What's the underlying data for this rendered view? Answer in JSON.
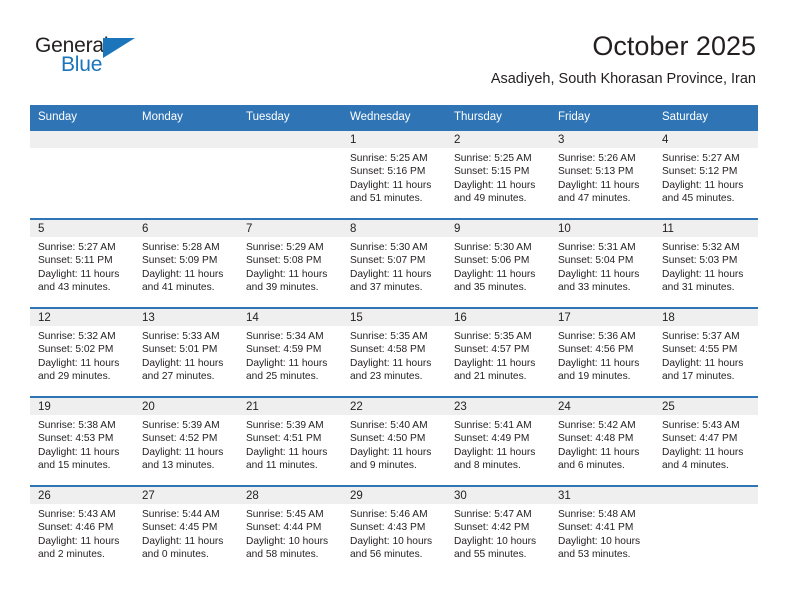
{
  "brand": {
    "name_top": "General",
    "name_bottom": "Blue",
    "triangle_color": "#1b75bb",
    "text_color": "#231f20"
  },
  "header": {
    "title": "October 2025",
    "subtitle": "Asadiyeh, South Khorasan Province, Iran"
  },
  "theme": {
    "header_blue": "#2f74b5",
    "daynum_band": "#efefef",
    "text": "#231f20",
    "cell_bg": "#ffffff"
  },
  "calendar": {
    "weekday_headers": [
      "Sunday",
      "Monday",
      "Tuesday",
      "Wednesday",
      "Thursday",
      "Friday",
      "Saturday"
    ],
    "weeks": [
      [
        {
          "day": "",
          "sunrise": "",
          "sunset": "",
          "daylight_line1": "",
          "daylight_line2": "",
          "empty": true
        },
        {
          "day": "",
          "sunrise": "",
          "sunset": "",
          "daylight_line1": "",
          "daylight_line2": "",
          "empty": true
        },
        {
          "day": "",
          "sunrise": "",
          "sunset": "",
          "daylight_line1": "",
          "daylight_line2": "",
          "empty": true
        },
        {
          "day": "1",
          "sunrise": "Sunrise: 5:25 AM",
          "sunset": "Sunset: 5:16 PM",
          "daylight_line1": "Daylight: 11 hours",
          "daylight_line2": "and 51 minutes."
        },
        {
          "day": "2",
          "sunrise": "Sunrise: 5:25 AM",
          "sunset": "Sunset: 5:15 PM",
          "daylight_line1": "Daylight: 11 hours",
          "daylight_line2": "and 49 minutes."
        },
        {
          "day": "3",
          "sunrise": "Sunrise: 5:26 AM",
          "sunset": "Sunset: 5:13 PM",
          "daylight_line1": "Daylight: 11 hours",
          "daylight_line2": "and 47 minutes."
        },
        {
          "day": "4",
          "sunrise": "Sunrise: 5:27 AM",
          "sunset": "Sunset: 5:12 PM",
          "daylight_line1": "Daylight: 11 hours",
          "daylight_line2": "and 45 minutes."
        }
      ],
      [
        {
          "day": "5",
          "sunrise": "Sunrise: 5:27 AM",
          "sunset": "Sunset: 5:11 PM",
          "daylight_line1": "Daylight: 11 hours",
          "daylight_line2": "and 43 minutes."
        },
        {
          "day": "6",
          "sunrise": "Sunrise: 5:28 AM",
          "sunset": "Sunset: 5:09 PM",
          "daylight_line1": "Daylight: 11 hours",
          "daylight_line2": "and 41 minutes."
        },
        {
          "day": "7",
          "sunrise": "Sunrise: 5:29 AM",
          "sunset": "Sunset: 5:08 PM",
          "daylight_line1": "Daylight: 11 hours",
          "daylight_line2": "and 39 minutes."
        },
        {
          "day": "8",
          "sunrise": "Sunrise: 5:30 AM",
          "sunset": "Sunset: 5:07 PM",
          "daylight_line1": "Daylight: 11 hours",
          "daylight_line2": "and 37 minutes."
        },
        {
          "day": "9",
          "sunrise": "Sunrise: 5:30 AM",
          "sunset": "Sunset: 5:06 PM",
          "daylight_line1": "Daylight: 11 hours",
          "daylight_line2": "and 35 minutes."
        },
        {
          "day": "10",
          "sunrise": "Sunrise: 5:31 AM",
          "sunset": "Sunset: 5:04 PM",
          "daylight_line1": "Daylight: 11 hours",
          "daylight_line2": "and 33 minutes."
        },
        {
          "day": "11",
          "sunrise": "Sunrise: 5:32 AM",
          "sunset": "Sunset: 5:03 PM",
          "daylight_line1": "Daylight: 11 hours",
          "daylight_line2": "and 31 minutes."
        }
      ],
      [
        {
          "day": "12",
          "sunrise": "Sunrise: 5:32 AM",
          "sunset": "Sunset: 5:02 PM",
          "daylight_line1": "Daylight: 11 hours",
          "daylight_line2": "and 29 minutes."
        },
        {
          "day": "13",
          "sunrise": "Sunrise: 5:33 AM",
          "sunset": "Sunset: 5:01 PM",
          "daylight_line1": "Daylight: 11 hours",
          "daylight_line2": "and 27 minutes."
        },
        {
          "day": "14",
          "sunrise": "Sunrise: 5:34 AM",
          "sunset": "Sunset: 4:59 PM",
          "daylight_line1": "Daylight: 11 hours",
          "daylight_line2": "and 25 minutes."
        },
        {
          "day": "15",
          "sunrise": "Sunrise: 5:35 AM",
          "sunset": "Sunset: 4:58 PM",
          "daylight_line1": "Daylight: 11 hours",
          "daylight_line2": "and 23 minutes."
        },
        {
          "day": "16",
          "sunrise": "Sunrise: 5:35 AM",
          "sunset": "Sunset: 4:57 PM",
          "daylight_line1": "Daylight: 11 hours",
          "daylight_line2": "and 21 minutes."
        },
        {
          "day": "17",
          "sunrise": "Sunrise: 5:36 AM",
          "sunset": "Sunset: 4:56 PM",
          "daylight_line1": "Daylight: 11 hours",
          "daylight_line2": "and 19 minutes."
        },
        {
          "day": "18",
          "sunrise": "Sunrise: 5:37 AM",
          "sunset": "Sunset: 4:55 PM",
          "daylight_line1": "Daylight: 11 hours",
          "daylight_line2": "and 17 minutes."
        }
      ],
      [
        {
          "day": "19",
          "sunrise": "Sunrise: 5:38 AM",
          "sunset": "Sunset: 4:53 PM",
          "daylight_line1": "Daylight: 11 hours",
          "daylight_line2": "and 15 minutes."
        },
        {
          "day": "20",
          "sunrise": "Sunrise: 5:39 AM",
          "sunset": "Sunset: 4:52 PM",
          "daylight_line1": "Daylight: 11 hours",
          "daylight_line2": "and 13 minutes."
        },
        {
          "day": "21",
          "sunrise": "Sunrise: 5:39 AM",
          "sunset": "Sunset: 4:51 PM",
          "daylight_line1": "Daylight: 11 hours",
          "daylight_line2": "and 11 minutes."
        },
        {
          "day": "22",
          "sunrise": "Sunrise: 5:40 AM",
          "sunset": "Sunset: 4:50 PM",
          "daylight_line1": "Daylight: 11 hours",
          "daylight_line2": "and 9 minutes."
        },
        {
          "day": "23",
          "sunrise": "Sunrise: 5:41 AM",
          "sunset": "Sunset: 4:49 PM",
          "daylight_line1": "Daylight: 11 hours",
          "daylight_line2": "and 8 minutes."
        },
        {
          "day": "24",
          "sunrise": "Sunrise: 5:42 AM",
          "sunset": "Sunset: 4:48 PM",
          "daylight_line1": "Daylight: 11 hours",
          "daylight_line2": "and 6 minutes."
        },
        {
          "day": "25",
          "sunrise": "Sunrise: 5:43 AM",
          "sunset": "Sunset: 4:47 PM",
          "daylight_line1": "Daylight: 11 hours",
          "daylight_line2": "and 4 minutes."
        }
      ],
      [
        {
          "day": "26",
          "sunrise": "Sunrise: 5:43 AM",
          "sunset": "Sunset: 4:46 PM",
          "daylight_line1": "Daylight: 11 hours",
          "daylight_line2": "and 2 minutes."
        },
        {
          "day": "27",
          "sunrise": "Sunrise: 5:44 AM",
          "sunset": "Sunset: 4:45 PM",
          "daylight_line1": "Daylight: 11 hours",
          "daylight_line2": "and 0 minutes."
        },
        {
          "day": "28",
          "sunrise": "Sunrise: 5:45 AM",
          "sunset": "Sunset: 4:44 PM",
          "daylight_line1": "Daylight: 10 hours",
          "daylight_line2": "and 58 minutes."
        },
        {
          "day": "29",
          "sunrise": "Sunrise: 5:46 AM",
          "sunset": "Sunset: 4:43 PM",
          "daylight_line1": "Daylight: 10 hours",
          "daylight_line2": "and 56 minutes."
        },
        {
          "day": "30",
          "sunrise": "Sunrise: 5:47 AM",
          "sunset": "Sunset: 4:42 PM",
          "daylight_line1": "Daylight: 10 hours",
          "daylight_line2": "and 55 minutes."
        },
        {
          "day": "31",
          "sunrise": "Sunrise: 5:48 AM",
          "sunset": "Sunset: 4:41 PM",
          "daylight_line1": "Daylight: 10 hours",
          "daylight_line2": "and 53 minutes."
        },
        {
          "day": "",
          "sunrise": "",
          "sunset": "",
          "daylight_line1": "",
          "daylight_line2": "",
          "empty": true
        }
      ]
    ]
  }
}
